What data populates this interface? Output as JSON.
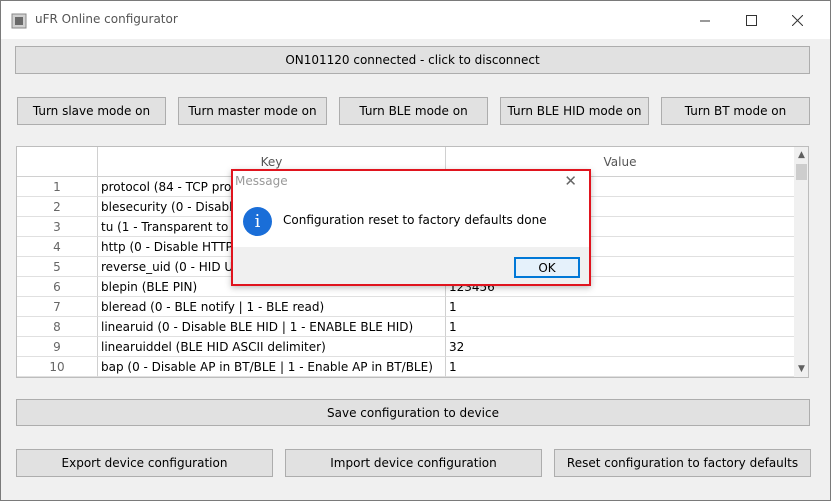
{
  "window": {
    "title": "uFR Online configurator"
  },
  "connection_button": "ON101120 connected - click to disconnect",
  "mode_buttons": [
    "Turn slave mode on",
    "Turn master mode on",
    "Turn BLE mode on",
    "Turn BLE HID mode on",
    "Turn BT mode on"
  ],
  "table": {
    "columns": {
      "key": "Key",
      "value": "Value"
    },
    "rows": [
      {
        "num": "1",
        "key": "protocol (84 - TCP proto",
        "value": ""
      },
      {
        "num": "2",
        "key": "blesecurity (0 - Disable B",
        "value": ""
      },
      {
        "num": "3",
        "key": "tu (1 - Transparent to UA",
        "value": ""
      },
      {
        "num": "4",
        "key": "http (0 - Disable HTTP | 1",
        "value": ""
      },
      {
        "num": "5",
        "key": "reverse_uid (0 - HID UID",
        "value": ""
      },
      {
        "num": "6",
        "key": "blepin (BLE PIN)",
        "value": "123456"
      },
      {
        "num": "7",
        "key": "bleread (0 - BLE notify | 1 - BLE read)",
        "value": "1"
      },
      {
        "num": "8",
        "key": "linearuid (0 - Disable BLE HID | 1 - ENABLE BLE HID)",
        "value": "1"
      },
      {
        "num": "9",
        "key": "linearuiddel (BLE HID ASCII delimiter)",
        "value": "32"
      },
      {
        "num": "10",
        "key": "bap (0 - Disable AP in BT/BLE | 1 - Enable AP in BT/BLE)",
        "value": "1"
      }
    ]
  },
  "save_button": "Save configuration to device",
  "bottom_buttons": {
    "export": "Export device configuration",
    "import": "Import device configuration",
    "reset": "Reset configuration to factory defaults"
  },
  "dialog": {
    "title": "Message",
    "message": "Configuration reset to factory defaults done",
    "ok": "OK",
    "icon": "info-icon"
  }
}
